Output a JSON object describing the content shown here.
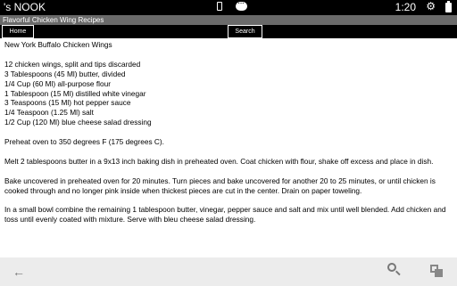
{
  "status_bar": {
    "app_name": "'s NOOK",
    "time": "1:20",
    "gear_icon": "gear-icon",
    "battery_icon": "battery-icon"
  },
  "app_bar": {
    "title": "Flavorful Chicken Wing Recipes"
  },
  "toolbar": {
    "home_label": "Home",
    "search_label": "Search"
  },
  "recipe": {
    "title": "New York Buffalo Chicken Wings",
    "ingredients": [
      "12 chicken wings, split and tips discarded",
      "3 Tablespoons (45 Ml) butter, divided",
      "1/4 Cup (60 Ml) all-purpose flour",
      "1 Tablespoon (15 Ml) distilled white vinegar",
      "3 Teaspoons (15 Ml) hot pepper sauce",
      "1/4 Teaspoon (1.25 Ml) salt",
      "1/2 Cup (120 Ml) blue cheese salad dressing"
    ],
    "steps": [
      "Preheat oven to 350 degrees F (175 degrees C).",
      "Melt 2 tablespoons butter in a 9x13 inch baking dish in preheated oven. Coat chicken with flour, shake off excess and place in dish.",
      "Bake uncovered in preheated oven for 20 minutes. Turn pieces and bake uncovered for another 20 to 25 minutes, or until chicken is cooked through and no longer pink inside when thickest pieces are cut in the center. Drain on paper toweling.",
      "In a small bowl combine the remaining 1 tablespoon butter, vinegar, pepper sauce and salt and mix until well blended. Add chicken and toss until evenly coated with mixture. Serve with bleu cheese salad dressing."
    ]
  },
  "nav_bar": {
    "back_icon": "back-arrow-icon",
    "search_icon": "search-icon",
    "recent_apps_icon": "recent-apps-icon",
    "back_glyph": "←"
  },
  "colors": {
    "status_bar_bg": "#000000",
    "app_bar_bg": "#6a6a6a",
    "content_bg": "#ffffff",
    "nav_bar_bg": "#ececec"
  }
}
